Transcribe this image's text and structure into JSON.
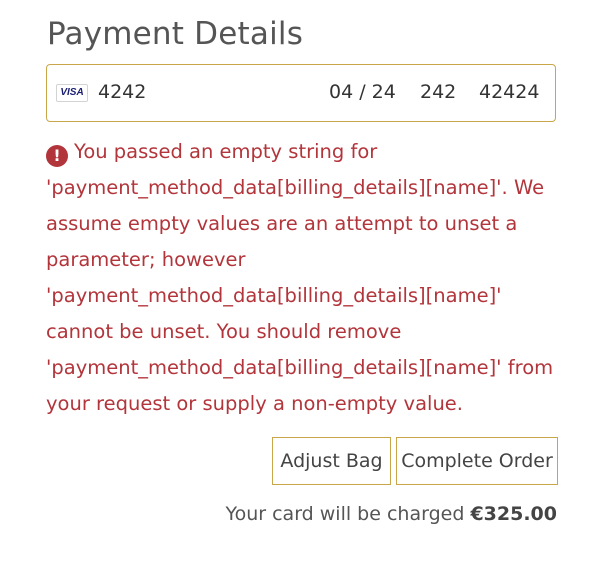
{
  "page": {
    "title": "Payment Details"
  },
  "card": {
    "brand": "VISA",
    "number": "4242",
    "expiry": "04 / 24",
    "cvc": "242",
    "postal": "42424"
  },
  "error": {
    "icon": "exclamation-circle-icon",
    "message": "You passed an empty string for 'payment_method_data[billing_details][name]'. We assume empty values are an attempt to unset a parameter; however 'payment_method_data[billing_details][name]' cannot be unset. You should remove 'payment_method_data[billing_details][name]' from your request or supply a non-empty value."
  },
  "actions": {
    "adjust_bag_label": "Adjust Bag",
    "complete_order_label": "Complete Order"
  },
  "summary": {
    "charge_label": "Your card will be charged",
    "amount": "€325.00"
  },
  "colors": {
    "accent_border": "#c9a64a",
    "error": "#b2353b",
    "text": "#555555"
  }
}
